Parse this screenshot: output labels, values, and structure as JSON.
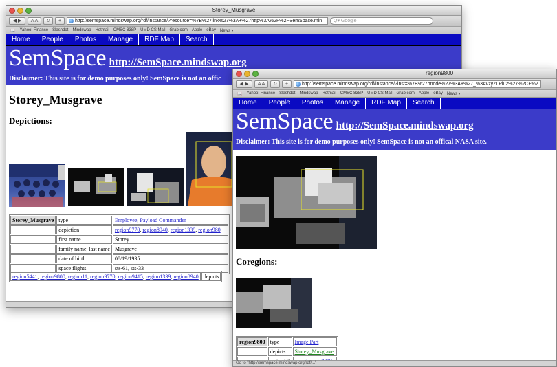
{
  "window1": {
    "title": "Storey_Musgrave",
    "url": "http://semspace.mindswap.org/rdf/instance/?resource=%7B%27link%27%3A+%27http%3A%2F%2FSemSpace.min",
    "search_placeholder": "Google",
    "bookmarks": [
      "Yahoo! Finance",
      "Slashdot",
      "Mindswap",
      "Hotmail",
      "CMSC 838P",
      "UMD CS Mail",
      "Grab.com",
      "Apple",
      "eBay",
      "News ▾"
    ],
    "nav": [
      "Home",
      "People",
      "Photos",
      "Manage",
      "RDF Map",
      "Search"
    ],
    "logo": "SemSpace",
    "logo_link": "http://SemSpace.mindswap.org",
    "disclaimer": "Disclaimer: This site is for demo purposes only! SemSpace is not an offic",
    "heading": "Storey_Musgrave",
    "subheading": "Depictions:",
    "table": {
      "subject": "Storey_Musgrave",
      "rows": [
        {
          "prop": "type",
          "links": [
            "Employee",
            "Payload Commander"
          ]
        },
        {
          "prop": "depiction",
          "links": [
            "region9770",
            "region8940",
            "region1339",
            "region980"
          ]
        },
        {
          "prop": "first name",
          "value": "Storey"
        },
        {
          "prop": "family name, last name",
          "value": "Musgrave"
        },
        {
          "prop": "date of birth",
          "value": "08/19/1935"
        },
        {
          "prop": "space flights",
          "value": "sts-61, sts-33"
        }
      ],
      "footer_links": [
        "region5441",
        "region9800",
        "region11",
        "region9770",
        "region9415",
        "region1339",
        "region8940"
      ],
      "footer_tail": "depicts"
    }
  },
  "window2": {
    "title": "region9800",
    "url": "http://semspace.mindswap.org/rdf/instance/?inst=%7B%27bnode%27%3A+%27_%3AvzyZLPiu2%27%2C+%2",
    "bookmarks": [
      "Yahoo! Finance",
      "Slashdot",
      "Mindswap",
      "Hotmail",
      "CMSC 838P",
      "UMD CS Mail",
      "Grab.com",
      "Apple",
      "eBay",
      "News ▾"
    ],
    "nav": [
      "Home",
      "People",
      "Photos",
      "Manage",
      "RDF Map",
      "Search"
    ],
    "logo": "SemSpace",
    "logo_link": "http://SemSpace.mindswap.org",
    "disclaimer": "Disclaimer: This site is for demo purposes only! SemSpace is not an offical NASA site.",
    "coregions_heading": "Coregions:",
    "table": {
      "subject": "region9800",
      "rows": [
        {
          "prop": "type",
          "link": "Image Part"
        },
        {
          "prop": "depicts",
          "link": "Storey_Musgrave"
        },
        {
          "prop": "regionOf",
          "link": "musgrave WFPC"
        }
      ]
    },
    "status_text": "Go to \"http://semspace.mindswap.org/rdf/...\""
  }
}
